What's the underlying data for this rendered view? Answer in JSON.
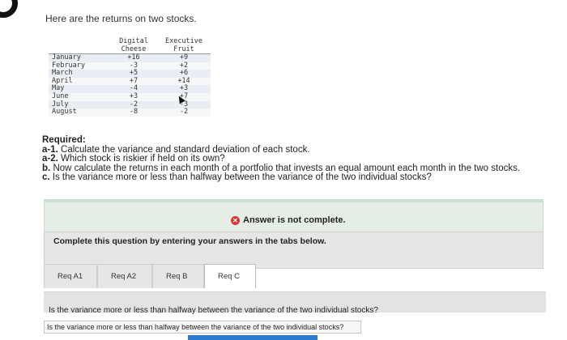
{
  "intro": "Here are the returns on two stocks.",
  "table": {
    "headers": [
      "",
      "Digital\nCheese",
      "Executive\nFruit"
    ],
    "rows": [
      {
        "month": "January",
        "digital": "+16",
        "executive": "+9"
      },
      {
        "month": "February",
        "digital": "-3",
        "executive": "+2"
      },
      {
        "month": "March",
        "digital": "+5",
        "executive": "+6"
      },
      {
        "month": "April",
        "digital": "+7",
        "executive": "+14"
      },
      {
        "month": "May",
        "digital": "-4",
        "executive": "+3"
      },
      {
        "month": "June",
        "digital": "+3",
        "executive": "+7"
      },
      {
        "month": "July",
        "digital": "-2",
        "executive": "-3"
      },
      {
        "month": "August",
        "digital": "-8",
        "executive": "-2"
      }
    ]
  },
  "required": {
    "heading": "Required:",
    "items": [
      {
        "label": "a-1.",
        "text": "Calculate the variance and standard deviation of each stock."
      },
      {
        "label": "a-2.",
        "text": "Which stock is riskier if held on its own?"
      },
      {
        "label": "b.",
        "text": "Now calculate the returns in each month of a portfolio that invests an equal amount each month in the two stocks."
      },
      {
        "label": "c.",
        "text": "Is the variance more or less than halfway between the variance of the two individual stocks?"
      }
    ]
  },
  "status": {
    "text": "Answer is not complete.",
    "icon": "x-circle-icon",
    "color": "#d9363e"
  },
  "tabs_intro": "Complete this question by entering your answers in the tabs below.",
  "tabs": [
    {
      "label": "Req A1"
    },
    {
      "label": "Req A2"
    },
    {
      "label": "Req B"
    },
    {
      "label": "Req C"
    }
  ],
  "question": "Is the variance more or less than halfway between the variance of the two individual stocks?",
  "answer_select": {
    "value": "Is the variance more or less than halfway between the variance of the two individual stocks?"
  }
}
